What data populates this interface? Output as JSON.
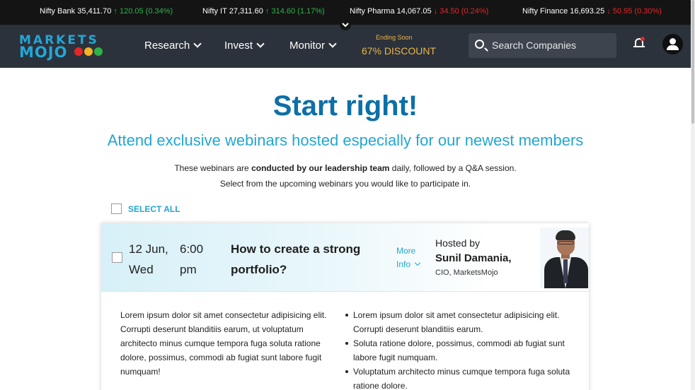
{
  "ticker": [
    {
      "name": "Nifty Bank",
      "value": "35,411.70",
      "direction": "up",
      "change": "120.05 (0.34%)"
    },
    {
      "name": "Nifty IT",
      "value": "27,311.60",
      "direction": "up",
      "change": "314.60 (1.17%)"
    },
    {
      "name": "Nifty Pharma",
      "value": "14,067.05",
      "direction": "down",
      "change": "34.50 (0.24%)"
    },
    {
      "name": "Nifty Finance",
      "value": "16,693.25",
      "direction": "down",
      "change": "50.95 (0.30%)"
    }
  ],
  "logo": {
    "line1": "MARKETS",
    "line2": "MOJO",
    "dot_colors": [
      "#e2262a",
      "#f0b323",
      "#2db34a"
    ]
  },
  "nav": {
    "items": [
      "Research",
      "Invest",
      "Monitor"
    ],
    "promo_small": "Ending Soon",
    "promo_big": "67% DISCOUNT",
    "search_placeholder": "Search Companies"
  },
  "colors": {
    "brand_blue": "#0d6fa7",
    "accent_cyan": "#24a6cf",
    "up_green": "#2db34a",
    "down_red": "#e2262a",
    "promo_gold": "#e9b54a",
    "nav_bg": "#2c323b"
  },
  "icons": {
    "arrow_up": "↑",
    "arrow_down": "↓",
    "collapse": "⌄"
  },
  "hero": {
    "title": "Start right!",
    "subtitle": "Attend exclusive webinars hosted especially for our newest members",
    "desc_1_a": "These webinars are ",
    "desc_1_b": "conducted by our leadership team",
    "desc_1_c": " daily, followed by a Q&A session.",
    "desc_2": "Select from the upcoming webinars you would like to participate in."
  },
  "select_all_label": "SELECT ALL",
  "webinar": {
    "date_line1": "12 Jun,",
    "date_line2": "Wed",
    "time_line1": "6:00",
    "time_line2": "pm",
    "title": "How to create a strong portfolio?",
    "more_line1": "More",
    "more_line2": "Info",
    "host_label": "Hosted by",
    "host_name": "Sunil Damania,",
    "host_role": "CIO, MarketsMojo",
    "body_left": "Lorem ipsum dolor sit amet consectetur adipisicing elit. Corrupti deserunt blanditiis earum, ut voluptatum architecto minus cumque tempora fuga soluta ratione dolore, possimus, commodi ab fugiat sunt labore fugit numquam!",
    "bullets": [
      "Lorem ipsum dolor sit amet consectetur adipisicing elit. Corrupti deserunt blanditiis earum.",
      "Soluta ratione dolore, possimus, commodi ab fugiat sunt labore fugit numquam.",
      "Voluptatum architecto minus cumque tempora fuga soluta ratione dolore."
    ]
  }
}
